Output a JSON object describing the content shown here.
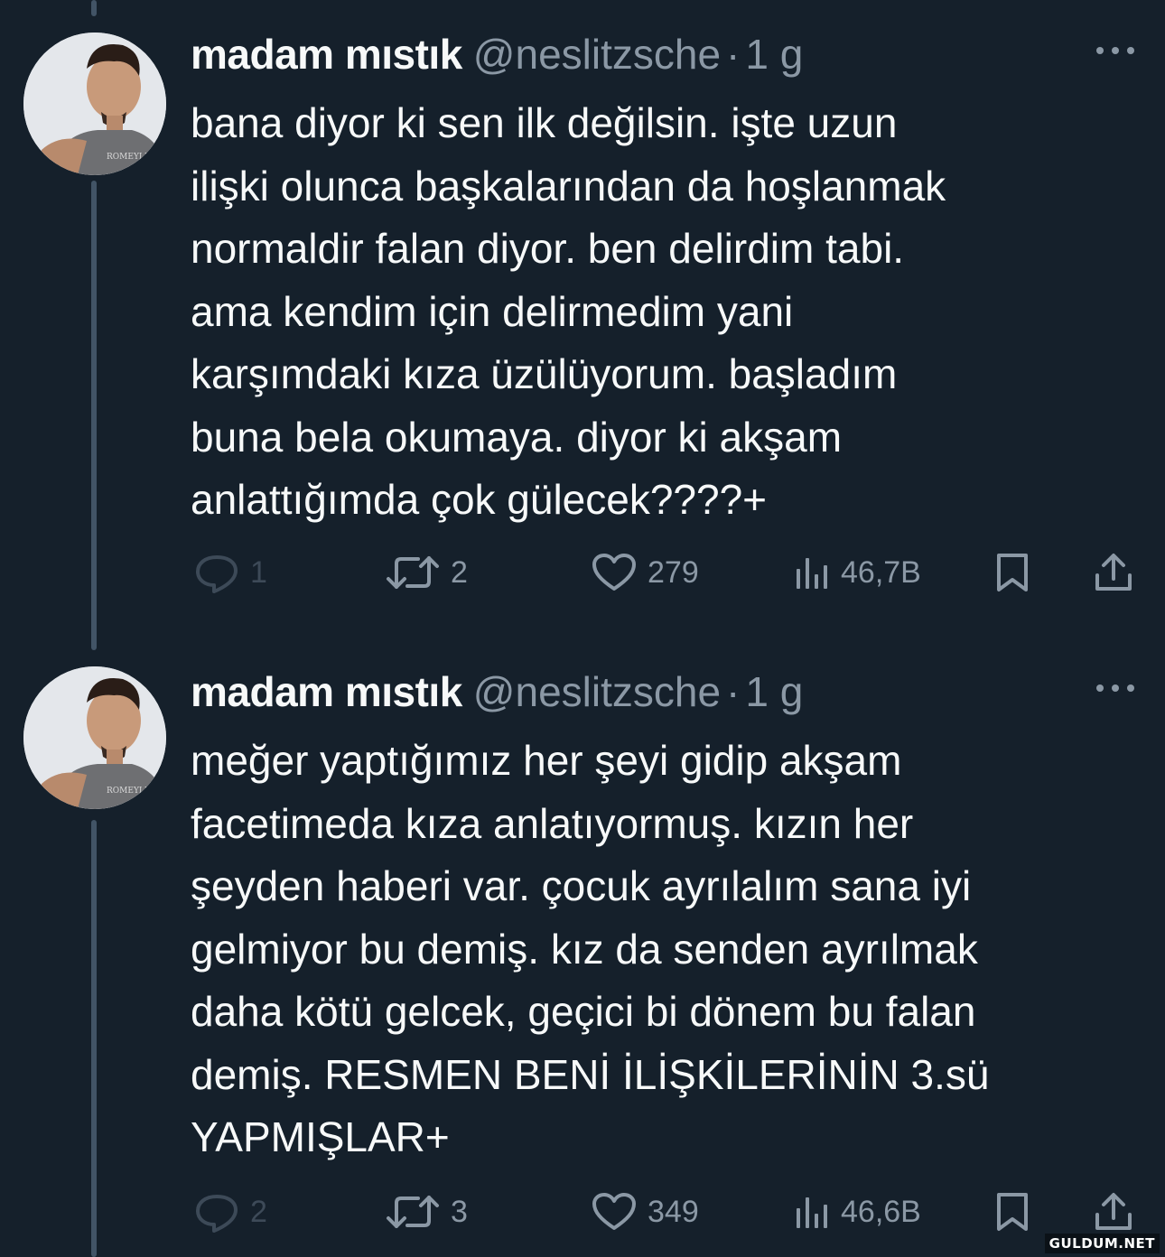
{
  "colors": {
    "background": "#15202b",
    "text_primary": "#f7f9f9",
    "text_secondary": "#8b98a5",
    "thread_line": "#425466"
  },
  "tweets": [
    {
      "display_name": "madam mıstık",
      "handle": "@neslitzsche",
      "separator": "·",
      "time": "1 g",
      "text": "bana diyor ki sen ilk değilsin. işte uzun\nilişki olunca başkalarından da hoşlanmak\nnormaldir falan diyor. ben delirdim tabi.\nama kendim için delirmedim yani\nkarşımdaki kıza üzülüyorum. başladım\nbuna bela okumaya. diyor ki akşam\nanlattığımda çok gülecek????+",
      "replies": "1",
      "retweets": "2",
      "likes": "279",
      "views": "46,7B",
      "icons": [
        "more-icon",
        "reply-icon",
        "retweet-icon",
        "like-icon",
        "views-icon",
        "bookmark-icon",
        "share-icon"
      ]
    },
    {
      "display_name": "madam mıstık",
      "handle": "@neslitzsche",
      "separator": "·",
      "time": "1 g",
      "text": "meğer yaptığımız her şeyi gidip akşam\nfacetimeda kıza anlatıyormuş. kızın her\nşeyden haberi var. çocuk ayrılalım sana iyi\ngelmiyor bu demiş. kız da senden ayrılmak\ndaha kötü gelcek, geçici bi dönem bu falan\ndemiş. RESMEN BENİ İLİŞKİLERİNİN 3.sü\nYAPMIŞLAR+",
      "replies": "2",
      "retweets": "3",
      "likes": "349",
      "views": "46,6B",
      "icons": [
        "more-icon",
        "reply-icon",
        "retweet-icon",
        "like-icon",
        "views-icon",
        "bookmark-icon",
        "share-icon"
      ]
    }
  ],
  "watermark": "GULDUM.NET"
}
